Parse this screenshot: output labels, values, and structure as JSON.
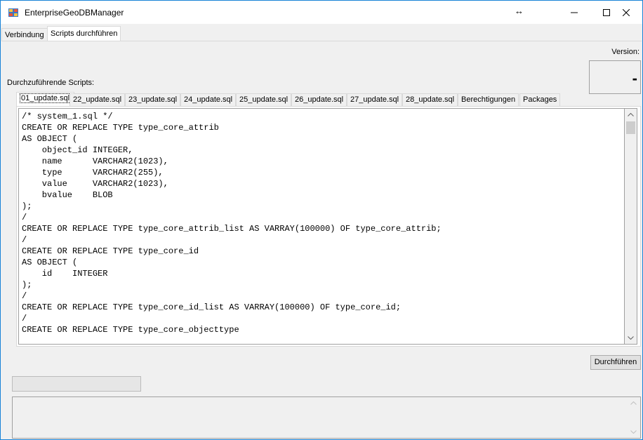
{
  "window": {
    "title": "EnterpriseGeoDBManager",
    "resize_glyph": "↔",
    "controls": {
      "minimize": "—",
      "maximize": "☐",
      "close": "✕"
    }
  },
  "main_tabs": [
    {
      "label": "Verbindung",
      "active": false
    },
    {
      "label": "Scripts durchführen",
      "active": true
    }
  ],
  "version": {
    "label": "Version:",
    "value": "-"
  },
  "scripts": {
    "label": "Durchzuführende Scripts:",
    "tabs": [
      {
        "label": "01_update.sql",
        "active": true
      },
      {
        "label": "22_update.sql",
        "active": false
      },
      {
        "label": "23_update.sql",
        "active": false
      },
      {
        "label": "24_update.sql",
        "active": false
      },
      {
        "label": "25_update.sql",
        "active": false
      },
      {
        "label": "26_update.sql",
        "active": false
      },
      {
        "label": "27_update.sql",
        "active": false
      },
      {
        "label": "28_update.sql",
        "active": false
      },
      {
        "label": "Berechtigungen",
        "active": false
      },
      {
        "label": "Packages",
        "active": false
      }
    ],
    "content": "/* system_1.sql */\nCREATE OR REPLACE TYPE type_core_attrib\nAS OBJECT (\n    object_id INTEGER,\n    name      VARCHAR2(1023),\n    type      VARCHAR2(255),\n    value     VARCHAR2(1023),\n    bvalue    BLOB\n);\n/\nCREATE OR REPLACE TYPE type_core_attrib_list AS VARRAY(100000) OF type_core_attrib;\n/\nCREATE OR REPLACE TYPE type_core_id\nAS OBJECT (\n    id    INTEGER\n);\n/\nCREATE OR REPLACE TYPE type_core_id_list AS VARRAY(100000) OF type_core_id;\n/\nCREATE OR REPLACE TYPE type_core_objecttype"
  },
  "actions": {
    "run_label": "Durchführen"
  },
  "progress": {
    "value": 0
  },
  "log": {
    "text": ""
  }
}
